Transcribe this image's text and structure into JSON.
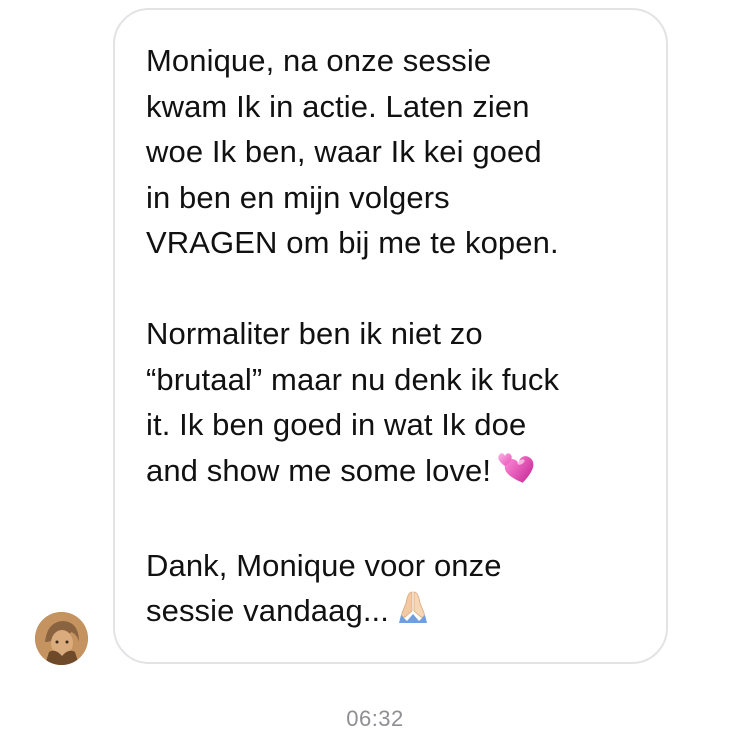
{
  "message": {
    "paragraphs": [
      {
        "lines": [
          "Monique, na onze sessie",
          "kwam Ik in actie. Laten zien",
          "woe Ik ben, waar Ik kei goed",
          "in ben en mijn volgers",
          "VRAGEN om bij me te kopen."
        ]
      },
      {
        "lines": [
          "Normaliter ben ik niet zo",
          "“brutaal” maar nu denk ik fuck",
          "it. Ik ben goed in wat Ik doe",
          "and show me some love!"
        ],
        "trailing_emoji": "two-hearts-icon"
      },
      {
        "lines": [
          "Dank, Monique voor onze",
          "sessie vandaag..."
        ],
        "trailing_emoji": "folded-hands-icon"
      }
    ]
  },
  "timestamp": "06:32",
  "colors": {
    "bubble_border": "#e3e3e6",
    "text": "#111111",
    "timestamp": "#8e8e93",
    "heart": "#e64db5",
    "hands": "#f2c9a3"
  }
}
